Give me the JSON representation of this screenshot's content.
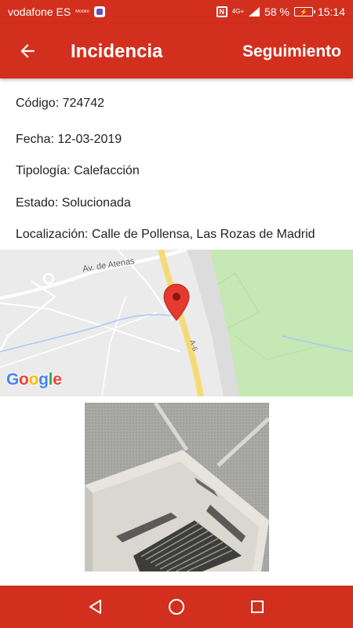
{
  "status_bar": {
    "carrier": "vodafone ES",
    "carrier_small": "Mobile",
    "network": "4G+",
    "battery": "58 %",
    "time": "15:14"
  },
  "app_bar": {
    "title": "Incidencia",
    "action": "Seguimiento",
    "back_icon": "arrow-left-icon"
  },
  "details": {
    "codigo": "Código: 724742",
    "fecha": "Fecha: 12-03-2019",
    "tipologia": "Tipología: Calefacción",
    "estado": "Estado: Solucionada",
    "localizacion": "Localización: Calle de Pollensa, Las Rozas de Madrid"
  },
  "map": {
    "street_label": "Av. de Atenas",
    "road_label": "A-6",
    "attribution": "Google",
    "marker_icon": "map-pin-icon"
  },
  "photo": {
    "subject": "ceiling-air-conditioner"
  },
  "nav_bar": {
    "back": "triangle-back-icon",
    "home": "circle-home-icon",
    "recents": "square-recents-icon"
  },
  "colors": {
    "primary": "#d32f1e",
    "text": "#222222"
  }
}
